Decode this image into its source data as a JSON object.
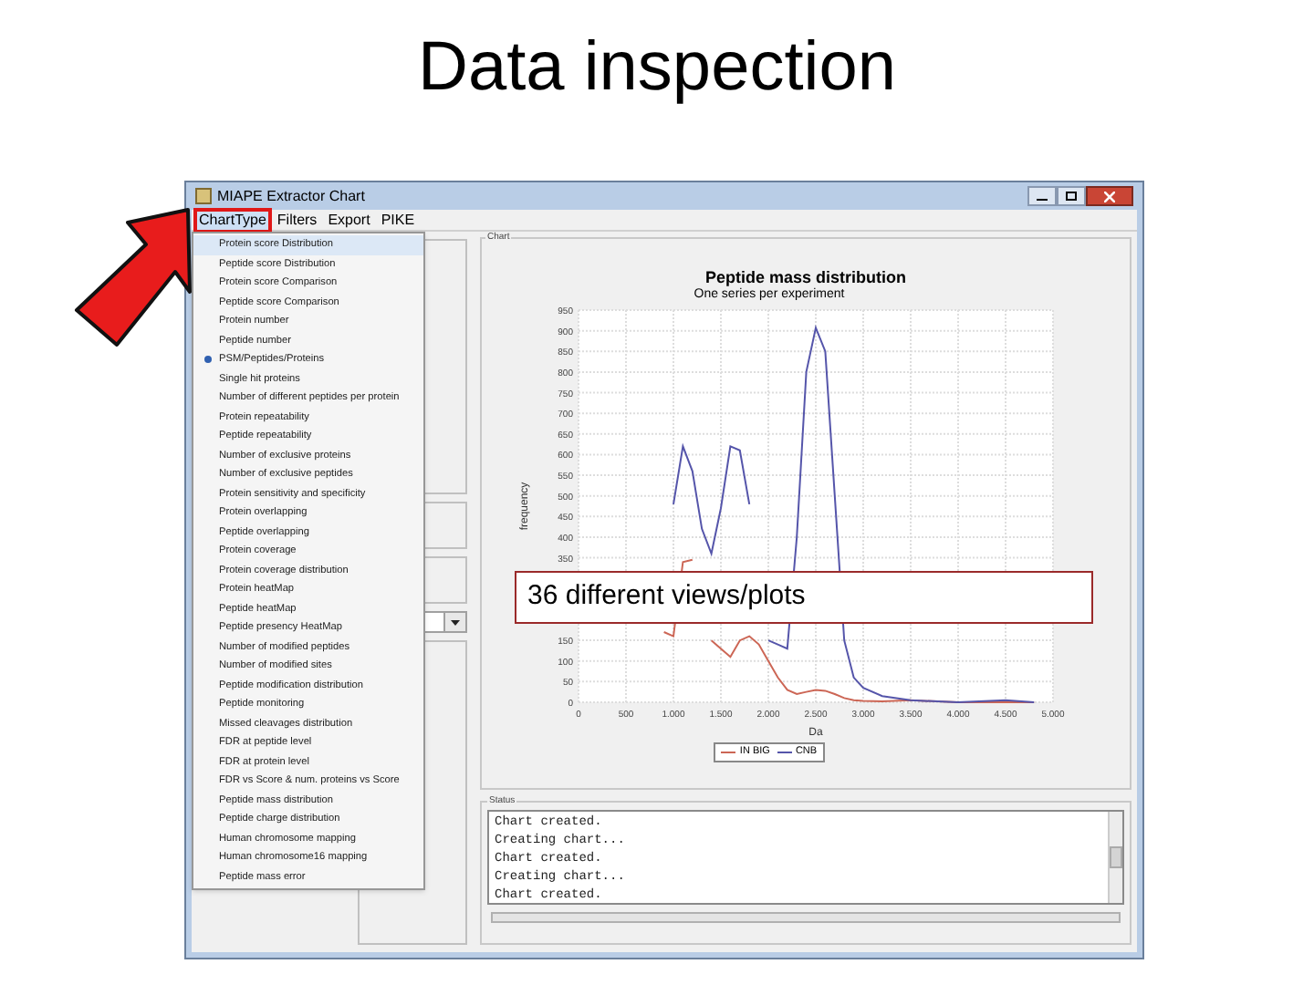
{
  "slide_title": "Data inspection",
  "window": {
    "title": "MIAPE Extractor Chart"
  },
  "menu_bar": [
    {
      "label": "ChartType",
      "highlighted": true
    },
    {
      "label": "Filters",
      "highlighted": false
    },
    {
      "label": "Export",
      "highlighted": false
    },
    {
      "label": "PIKE",
      "highlighted": false
    }
  ],
  "chart_type_menu": [
    {
      "label": "Protein score Distribution",
      "selected": false,
      "hovered": true
    },
    {
      "label": "Peptide score Distribution",
      "selected": false,
      "hovered": false
    },
    {
      "label": "Protein score Comparison",
      "selected": false,
      "hovered": false
    },
    {
      "label": "Peptide score Comparison",
      "selected": false,
      "hovered": false
    },
    {
      "label": "Protein number",
      "selected": false,
      "hovered": false
    },
    {
      "label": "Peptide number",
      "selected": false,
      "hovered": false
    },
    {
      "label": "PSM/Peptides/Proteins",
      "selected": true,
      "hovered": false
    },
    {
      "label": "Single hit proteins",
      "selected": false,
      "hovered": false
    },
    {
      "label": "Number of different peptides per protein",
      "selected": false,
      "hovered": false
    },
    {
      "label": "Protein repeatability",
      "selected": false,
      "hovered": false
    },
    {
      "label": "Peptide repeatability",
      "selected": false,
      "hovered": false
    },
    {
      "label": "Number of exclusive proteins",
      "selected": false,
      "hovered": false
    },
    {
      "label": "Number of exclusive peptides",
      "selected": false,
      "hovered": false
    },
    {
      "label": "Protein sensitivity and specificity",
      "selected": false,
      "hovered": false
    },
    {
      "label": "Protein overlapping",
      "selected": false,
      "hovered": false
    },
    {
      "label": "Peptide overlapping",
      "selected": false,
      "hovered": false
    },
    {
      "label": "Protein coverage",
      "selected": false,
      "hovered": false
    },
    {
      "label": "Protein coverage distribution",
      "selected": false,
      "hovered": false
    },
    {
      "label": "Protein heatMap",
      "selected": false,
      "hovered": false
    },
    {
      "label": "Peptide heatMap",
      "selected": false,
      "hovered": false
    },
    {
      "label": "Peptide presency HeatMap",
      "selected": false,
      "hovered": false
    },
    {
      "label": "Number of modified peptides",
      "selected": false,
      "hovered": false
    },
    {
      "label": "Number of modified sites",
      "selected": false,
      "hovered": false
    },
    {
      "label": "Peptide modification distribution",
      "selected": false,
      "hovered": false
    },
    {
      "label": "Peptide monitoring",
      "selected": false,
      "hovered": false
    },
    {
      "label": "Missed cleavages distribution",
      "selected": false,
      "hovered": false
    },
    {
      "label": "FDR at peptide level",
      "selected": false,
      "hovered": false
    },
    {
      "label": "FDR at protein level",
      "selected": false,
      "hovered": false
    },
    {
      "label": "FDR vs Score & num. proteins vs Score",
      "selected": false,
      "hovered": false
    },
    {
      "label": "Peptide mass distribution",
      "selected": false,
      "hovered": false
    },
    {
      "label": "Peptide charge distribution",
      "selected": false,
      "hovered": false
    },
    {
      "label": "Human chromosome mapping",
      "selected": false,
      "hovered": false
    },
    {
      "label": "Human chromosome16 mapping",
      "selected": false,
      "hovered": false
    },
    {
      "label": "Peptide mass error",
      "selected": false,
      "hovered": false
    }
  ],
  "chart_panel": {
    "label": "Chart",
    "subtitle": "One series per experiment",
    "chart_data": {
      "type": "line",
      "title": "Peptide mass distribution",
      "xlabel": "Da",
      "ylabel": "frequency",
      "x": [
        900,
        1000,
        1100,
        1200,
        1300,
        1400,
        1500,
        1600,
        1700,
        1800,
        1900,
        2000,
        2100,
        2200,
        2300,
        2400,
        2500,
        2600,
        2700,
        2800,
        2900,
        3000,
        3200,
        3500,
        4000,
        4500,
        4800
      ],
      "series": [
        {
          "name": "IN BIG",
          "color": "#cc6655",
          "values": [
            170,
            160,
            340,
            345,
            null,
            150,
            130,
            110,
            150,
            160,
            140,
            100,
            60,
            30,
            20,
            25,
            30,
            28,
            20,
            10,
            5,
            3,
            2,
            5,
            0,
            0,
            0
          ]
        },
        {
          "name": "CNB",
          "color": "#5555aa",
          "values": [
            null,
            480,
            620,
            560,
            420,
            360,
            470,
            620,
            610,
            480,
            null,
            150,
            140,
            130,
            400,
            800,
            907,
            850,
            500,
            150,
            60,
            35,
            15,
            5,
            0,
            5,
            0
          ]
        }
      ],
      "xlim": [
        0,
        5000
      ],
      "ylim": [
        0,
        950
      ],
      "grid": true,
      "xticks": [
        0,
        500,
        {
          "value": 1000,
          "label": "1.000"
        },
        {
          "value": 1500,
          "label": "1.500"
        },
        {
          "value": 2000,
          "label": "2.000"
        },
        {
          "value": 2500,
          "label": "2.500"
        },
        {
          "value": 3000,
          "label": "3.000"
        },
        {
          "value": 3500,
          "label": "3.500"
        },
        {
          "value": 4000,
          "label": "4.000"
        },
        {
          "value": 4500,
          "label": "4.500"
        },
        {
          "value": 5000,
          "label": "5.000"
        }
      ],
      "yticks": [
        0,
        50,
        100,
        150,
        350,
        400,
        450,
        500,
        550,
        600,
        650,
        700,
        750,
        800,
        850,
        900,
        950
      ]
    }
  },
  "callout": "36 different views/plots",
  "status_panel": {
    "label": "Status",
    "lines": [
      "Chart created.",
      "Creating chart...",
      "Chart created.",
      "Creating chart...",
      "Chart created."
    ],
    "progress": {
      "level": 0
    }
  }
}
